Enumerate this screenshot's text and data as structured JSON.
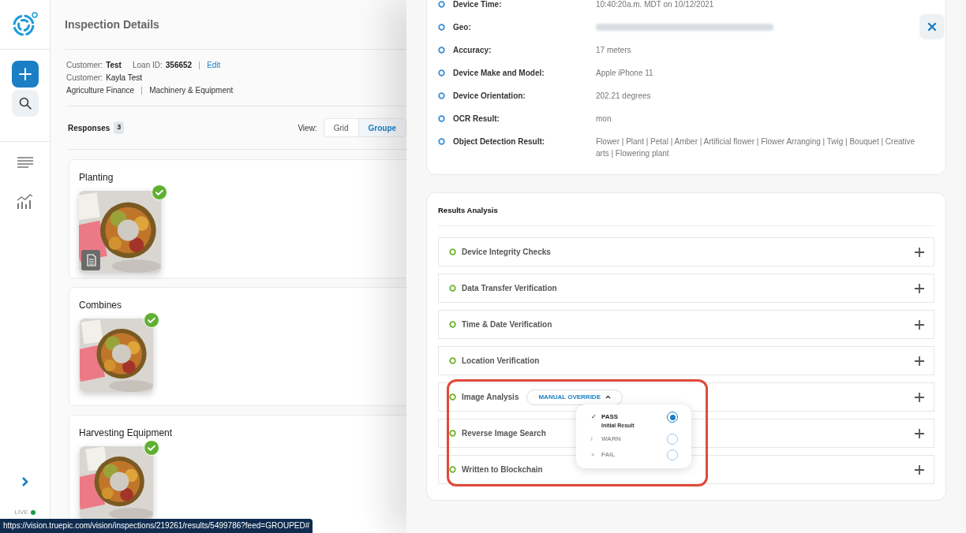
{
  "sidebar": {
    "live_label": "LIVE"
  },
  "inspection": {
    "title": "Inspection Details",
    "fields": [
      {
        "label": "Customer:",
        "value": "Test"
      },
      {
        "label": "Loan ID:",
        "value": "356652"
      }
    ],
    "edit_link": "Edit",
    "customer": {
      "label": "Customer:",
      "value": "Kayla Test"
    },
    "categories": [
      "Agriculture Finance",
      "Machinery & Equipment"
    ]
  },
  "responses": {
    "label": "Responses",
    "count": "3",
    "view_label": "View:",
    "view_options": [
      {
        "label": "Grid",
        "selected": false
      },
      {
        "label": "Groupe",
        "selected": true
      }
    ],
    "groups": [
      {
        "title": "Planting",
        "photos": [
          {
            "verified": true,
            "has_note": true
          }
        ]
      },
      {
        "title": "Combines",
        "photos": [
          {
            "verified": true,
            "has_note": false
          }
        ]
      },
      {
        "title": "Harvesting Equipment",
        "photos": [
          {
            "verified": true,
            "has_note": false
          }
        ]
      }
    ]
  },
  "details": {
    "rows": [
      {
        "label": "Device Time:",
        "value": "10:40:20a.m. MDT on 10/12/2021"
      },
      {
        "label": "Geo:",
        "redacted": true
      },
      {
        "label": "Accuracy:",
        "value": "17 meters"
      },
      {
        "label": "Device Make and Model:",
        "value": "Apple iPhone 11"
      },
      {
        "label": "Device Orientation:",
        "value": "202.21 degrees"
      },
      {
        "label": "OCR Result:",
        "value": "mon"
      },
      {
        "label": "Object Detection Result:",
        "value": "Flower | Plant | Petal | Amber | Artificial flower | Flower Arranging | Twig | Bouquet | Creative arts | Flowering plant"
      }
    ]
  },
  "results": {
    "title": "Results Analysis",
    "checks": [
      {
        "name": "Device Integrity Checks"
      },
      {
        "name": "Data Transfer Verification"
      },
      {
        "name": "Time & Date Verification"
      },
      {
        "name": "Location Verification"
      },
      {
        "name": "Image Analysis",
        "override": {
          "label": "MANUAL OVERRIDE",
          "expanded": true,
          "options": [
            {
              "symbol": "✓",
              "label": "PASS",
              "note": "Initial Result",
              "selected": true
            },
            {
              "symbol": "i",
              "label": "WARN",
              "selected": false
            },
            {
              "symbol": "×",
              "label": "FAIL",
              "selected": false
            }
          ]
        }
      },
      {
        "name": "Reverse Image Search"
      },
      {
        "name": "Written to Blockchain"
      }
    ]
  },
  "status_bar": {
    "url": "https://vision.truepic.com/vision/inspections/219261/results/5499786?feed=GROUPED#"
  }
}
